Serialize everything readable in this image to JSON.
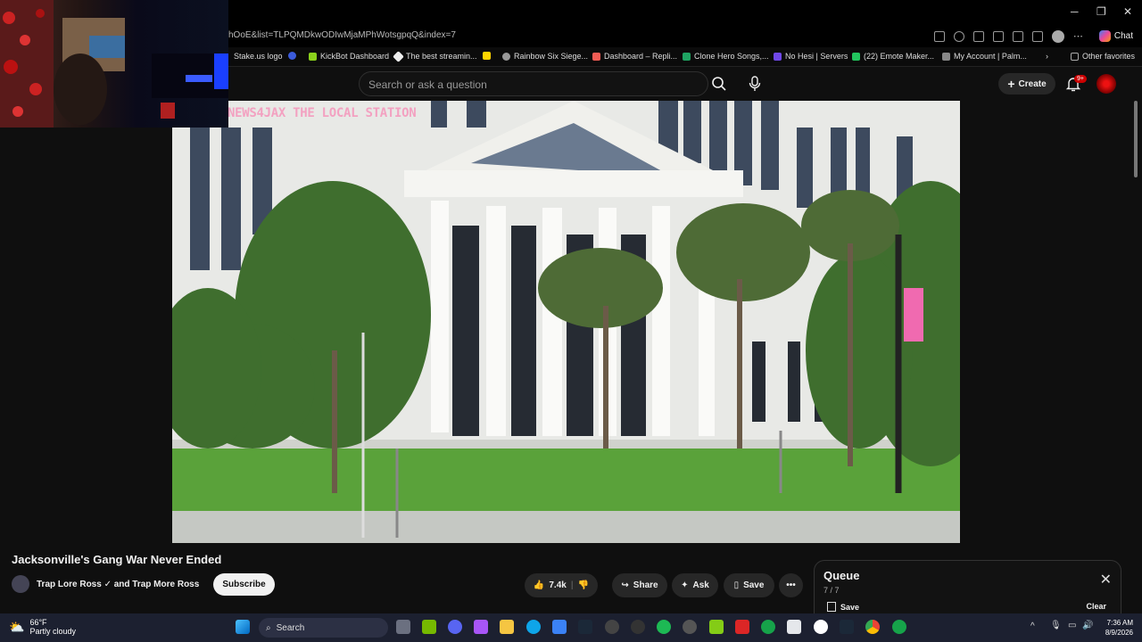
{
  "browser": {
    "url": "hOoE&list=TLPQMDkwODIwMjaMPhWotsgpqQ&index=7",
    "chat_label": "Chat",
    "window_controls": [
      "─",
      "❐",
      "✕"
    ],
    "favorites": [
      {
        "label": "Stake.us logo",
        "color": "#222"
      },
      {
        "label": "",
        "color": "#3b5bdb",
        "glyph": "R"
      },
      {
        "label": "KickBot Dashboard",
        "color": "#8bd11c"
      },
      {
        "label": "The best streamin...",
        "color": "#eee"
      },
      {
        "label": "",
        "color": "#ffd400"
      },
      {
        "label": "Rainbow Six Siege...",
        "color": "#999"
      },
      {
        "label": "Dashboard – Repli...",
        "color": "#f25c54"
      },
      {
        "label": "Clone Hero Songs,...",
        "color": "#1fa463"
      },
      {
        "label": "No Hesi | Servers",
        "color": "#7048e8"
      },
      {
        "label": "(22) Emote Maker...",
        "color": "#22c55e"
      },
      {
        "label": "My Account | Palm...",
        "color": "#888"
      },
      {
        "label": "Other favorites",
        "color": "#888"
      }
    ]
  },
  "youtube": {
    "search_placeholder": "Search or ask a question",
    "create_label": "Create",
    "notif_badge": "9+",
    "watermark": "NEWS4JAX THE LOCAL STATION",
    "video_title": "Jacksonville's Gang War Never Ended",
    "channel": "Trap Lore Ross ✓ and Trap More Ross",
    "subscribe": "Subscribe",
    "actions": {
      "likes": "7.4k",
      "share": "Share",
      "ask": "Ask",
      "save": "Save"
    },
    "queue": {
      "title": "Queue",
      "count": "7 / 7",
      "save": "Save",
      "clear": "Clear"
    }
  },
  "taskbar": {
    "temp": "66°F",
    "condition": "Partly cloudy",
    "search": "Search",
    "time": "7:36 AM",
    "date": "8/9/2026"
  }
}
